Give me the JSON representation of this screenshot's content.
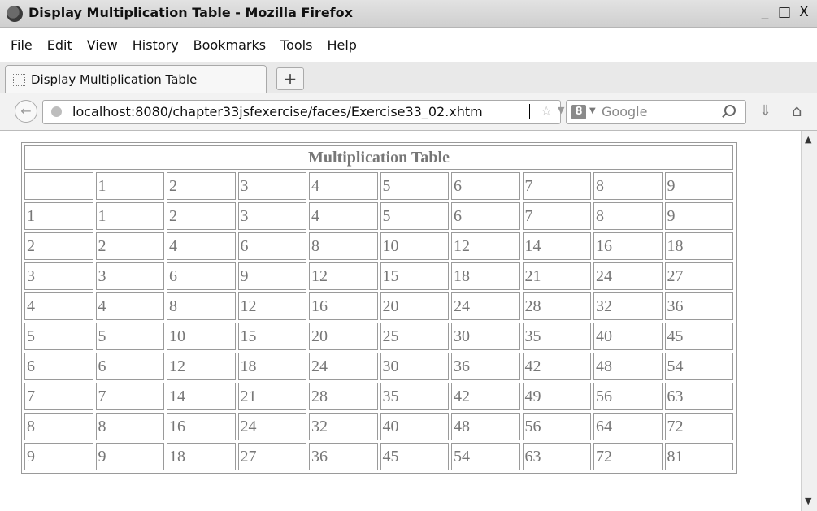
{
  "window": {
    "title": "Display Multiplication Table - Mozilla Firefox",
    "controls": {
      "minimize": "_",
      "maximize": "□",
      "close": "X"
    }
  },
  "menu": [
    "File",
    "Edit",
    "View",
    "History",
    "Bookmarks",
    "Tools",
    "Help"
  ],
  "tab": {
    "label": "Display Multiplication Table",
    "new_tab": "+"
  },
  "nav": {
    "url": "localhost:8080/chapter33jsfexercise/faces/Exercise33_02.xhtm",
    "search_placeholder": "Google",
    "search_engine_icon": "8"
  },
  "table": {
    "title": "Multiplication Table",
    "header": [
      "",
      "1",
      "2",
      "3",
      "4",
      "5",
      "6",
      "7",
      "8",
      "9"
    ],
    "rows": [
      [
        "1",
        "1",
        "2",
        "3",
        "4",
        "5",
        "6",
        "7",
        "8",
        "9"
      ],
      [
        "2",
        "2",
        "4",
        "6",
        "8",
        "10",
        "12",
        "14",
        "16",
        "18"
      ],
      [
        "3",
        "3",
        "6",
        "9",
        "12",
        "15",
        "18",
        "21",
        "24",
        "27"
      ],
      [
        "4",
        "4",
        "8",
        "12",
        "16",
        "20",
        "24",
        "28",
        "32",
        "36"
      ],
      [
        "5",
        "5",
        "10",
        "15",
        "20",
        "25",
        "30",
        "35",
        "40",
        "45"
      ],
      [
        "6",
        "6",
        "12",
        "18",
        "24",
        "30",
        "36",
        "42",
        "48",
        "54"
      ],
      [
        "7",
        "7",
        "14",
        "21",
        "28",
        "35",
        "42",
        "49",
        "56",
        "63"
      ],
      [
        "8",
        "8",
        "16",
        "24",
        "32",
        "40",
        "48",
        "56",
        "64",
        "72"
      ],
      [
        "9",
        "9",
        "18",
        "27",
        "36",
        "45",
        "54",
        "63",
        "72",
        "81"
      ]
    ]
  }
}
